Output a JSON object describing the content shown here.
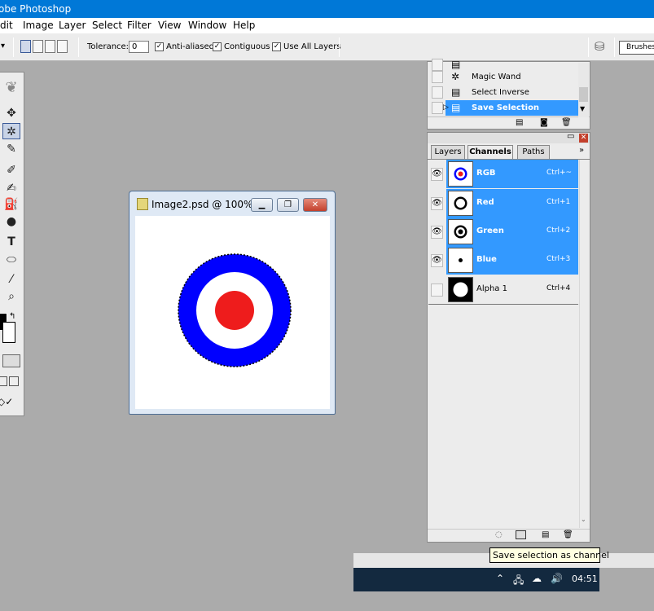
{
  "app": {
    "title": "Adobe Photoshop",
    "visible_title": "obe Photoshop"
  },
  "menu": [
    "dit",
    "Image",
    "Layer",
    "Select",
    "Filter",
    "View",
    "Window",
    "Help"
  ],
  "options": {
    "tolerance_label": "Tolerance:",
    "tolerance_value": "0",
    "anti_aliased_label": "Anti-aliased",
    "anti_aliased": true,
    "contiguous_label": "Contiguous",
    "contiguous": true,
    "use_all_layers_label": "Use All Layers",
    "use_all_layers": true,
    "brushes_label": "Brushes"
  },
  "document": {
    "title": "Image2.psd @ 100% (...",
    "colors": {
      "ring": "#0000ff",
      "inner": "#ffffff",
      "center": "#ee1c1c"
    }
  },
  "history": {
    "items": [
      {
        "label": "Magic Wand",
        "icon": "magic-wand-icon",
        "active": false
      },
      {
        "label": "Select Inverse",
        "icon": "history-state-icon",
        "active": false
      },
      {
        "label": "Save Selection",
        "icon": "history-state-icon",
        "active": true
      }
    ]
  },
  "channels_panel": {
    "tabs": [
      {
        "label": "Layers",
        "active": false
      },
      {
        "label": "Channels",
        "active": true
      },
      {
        "label": "Paths",
        "active": false
      }
    ],
    "channels": [
      {
        "name": "RGB",
        "shortcut": "Ctrl+~",
        "visible": true,
        "selected": true
      },
      {
        "name": "Red",
        "shortcut": "Ctrl+1",
        "visible": true,
        "selected": true
      },
      {
        "name": "Green",
        "shortcut": "Ctrl+2",
        "visible": true,
        "selected": true
      },
      {
        "name": "Blue",
        "shortcut": "Ctrl+3",
        "visible": true,
        "selected": true
      },
      {
        "name": "Alpha 1",
        "shortcut": "Ctrl+4",
        "visible": false,
        "selected": false
      }
    ]
  },
  "tooltip": "Save selection as channel",
  "taskbar": {
    "clock": "04:51"
  },
  "colors": {
    "accent": "#3399ff",
    "titlebar": "#0078d7",
    "workspace": "#ababab"
  }
}
